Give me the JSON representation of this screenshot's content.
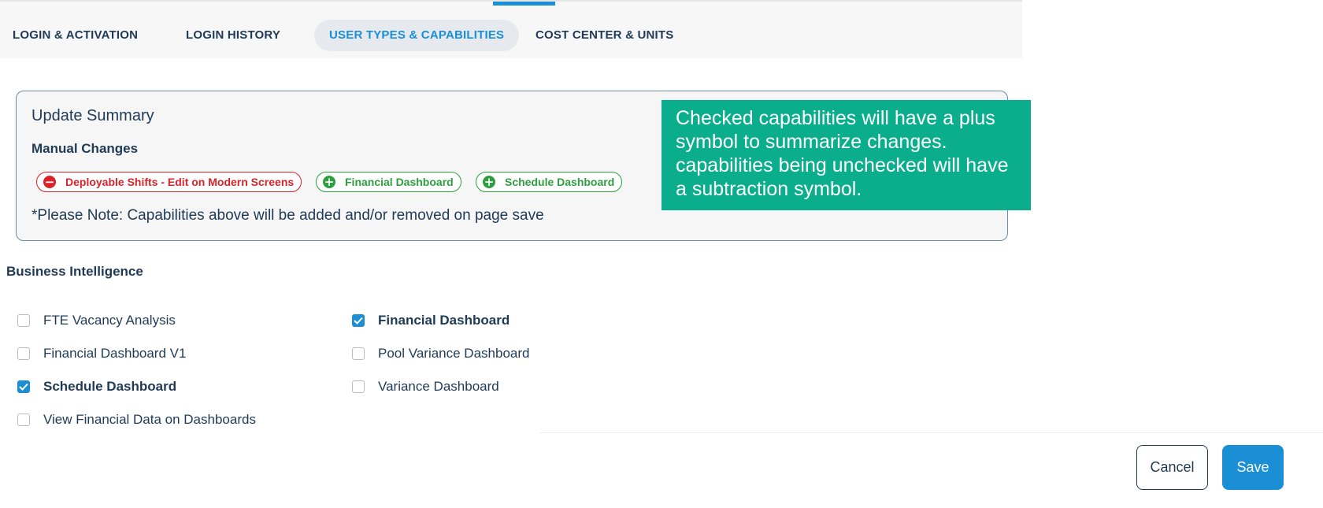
{
  "tabs": [
    {
      "label": "LOGIN & ACTIVATION",
      "active": false
    },
    {
      "label": "LOGIN HISTORY",
      "active": false
    },
    {
      "label": "USER TYPES & CAPABILITIES",
      "active": true
    },
    {
      "label": "COST CENTER & UNITS",
      "active": false
    }
  ],
  "update_summary": {
    "title": "Update Summary",
    "subtitle": "Manual Changes",
    "changes": [
      {
        "label": "Deployable Shifts - Edit on Modern Screens",
        "type": "remove",
        "icon": "minus-circle-icon"
      },
      {
        "label": "Financial Dashboard",
        "type": "add",
        "icon": "plus-circle-icon"
      },
      {
        "label": "Schedule Dashboard",
        "type": "add",
        "icon": "plus-circle-icon"
      }
    ],
    "note": "*Please Note: Capabilities above will be added and/or removed on page save"
  },
  "callout": {
    "text": "Checked capabilities will have a plus symbol to summarize changes. capabilities being unchecked will have a subtraction symbol."
  },
  "section": {
    "title": "Business Intelligence",
    "capabilities": [
      {
        "label": "FTE Vacancy Analysis",
        "checked": false
      },
      {
        "label": "Financial Dashboard",
        "checked": true
      },
      {
        "label": "Financial Dashboard V1",
        "checked": false
      },
      {
        "label": "Pool Variance Dashboard",
        "checked": false
      },
      {
        "label": "Schedule Dashboard",
        "checked": true
      },
      {
        "label": "Variance Dashboard",
        "checked": false
      },
      {
        "label": "View Financial Data on Dashboards",
        "checked": false
      }
    ]
  },
  "footer": {
    "cancel_label": "Cancel",
    "save_label": "Save"
  },
  "colors": {
    "primary": "#1a8fd6",
    "text": "#1f3a57",
    "remove": "#d8232a",
    "add": "#2e9e3f",
    "callout_bg": "#0aae8c"
  }
}
